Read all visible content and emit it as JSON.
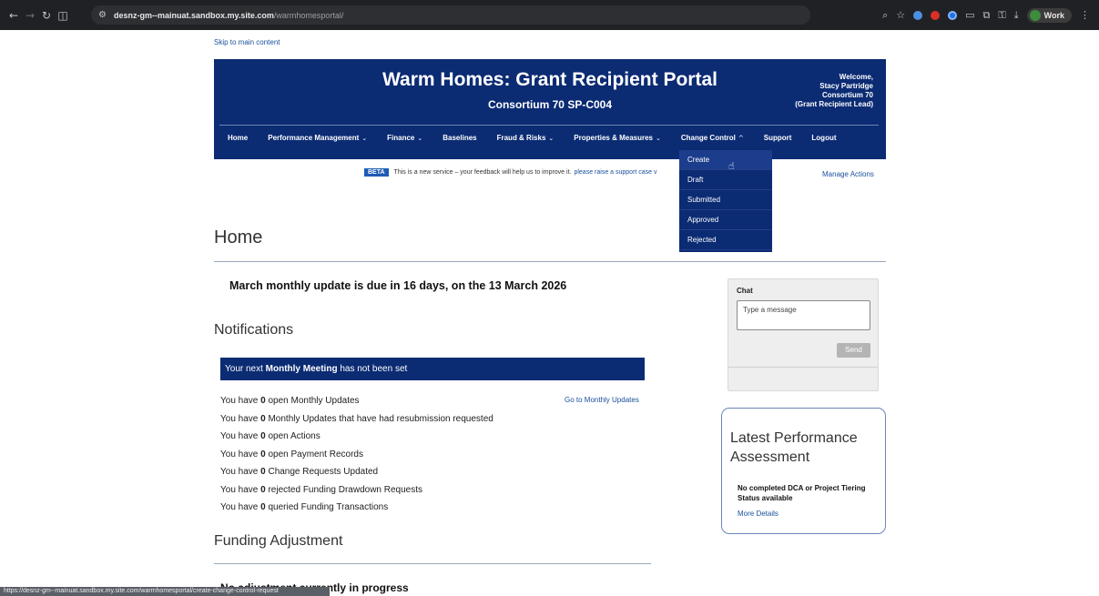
{
  "browser": {
    "url_host": "desnz-gm--mainuat.sandbox.my.site.com",
    "url_path": "/warmhomesportal/",
    "profile_label": "Work",
    "status_url": "https://desnz-gm--mainuat.sandbox.my.site.com/warmhomesportal/create-change-control-request"
  },
  "page": {
    "skip_link": "Skip to main content",
    "header": {
      "title": "Warm Homes: Grant Recipient Portal",
      "subtitle": "Consortium 70 SP-C004",
      "welcome": [
        "Welcome,",
        "Stacy Partridge",
        "Consortium 70",
        "(Grant Recipient Lead)"
      ]
    },
    "nav": [
      {
        "label": "Home",
        "chevron": ""
      },
      {
        "label": "Performance Management",
        "chevron": "⌄"
      },
      {
        "label": "Finance",
        "chevron": "⌄"
      },
      {
        "label": "Baselines",
        "chevron": ""
      },
      {
        "label": "Fraud & Risks",
        "chevron": "⌄"
      },
      {
        "label": "Properties & Measures",
        "chevron": "⌄"
      },
      {
        "label": "Change Control",
        "chevron": "^"
      },
      {
        "label": "Support",
        "chevron": ""
      },
      {
        "label": "Logout",
        "chevron": ""
      }
    ],
    "change_control_menu": [
      "Create",
      "Draft",
      "Submitted",
      "Approved",
      "Rejected"
    ],
    "beta": {
      "tag": "BETA",
      "text": "This is a new service – your feedback will help us to improve it.",
      "link": "please raise a support case v"
    },
    "manage_actions": "Manage Actions",
    "home_heading": "Home",
    "due_notice": "March monthly update is due in 16 days, on the 13 March 2026",
    "notifications": {
      "heading": "Notifications",
      "banner_prefix": "Your next ",
      "banner_bold": "Monthly Meeting",
      "banner_suffix": " has not been set",
      "go_link": "Go to Monthly Updates",
      "items": [
        {
          "pre": "You have ",
          "count": "0",
          "post": " open Monthly Updates"
        },
        {
          "pre": "You have ",
          "count": "0",
          "post": " Monthly Updates that have had resubmission requested"
        },
        {
          "pre": "You have ",
          "count": "0",
          "post": " open Actions"
        },
        {
          "pre": "You have ",
          "count": "0",
          "post": " open Payment Records"
        },
        {
          "pre": "You have ",
          "count": "0",
          "post": " Change Requests Updated"
        },
        {
          "pre": "You have ",
          "count": "0",
          "post": " rejected Funding Drawdown Requests"
        },
        {
          "pre": "You have ",
          "count": "0",
          "post": " queried Funding Transactions"
        }
      ]
    },
    "funding": {
      "heading": "Funding Adjustment",
      "status": "No adjustment currently in progress"
    },
    "chat": {
      "title": "Chat",
      "placeholder": "Type a message",
      "send": "Send"
    },
    "performance": {
      "title": "Latest Performance Assessment",
      "body": "No completed DCA or Project Tiering Status available",
      "link": "More Details"
    }
  }
}
